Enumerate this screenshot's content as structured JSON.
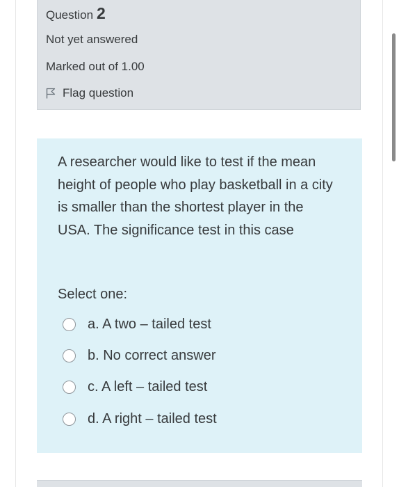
{
  "question_info": {
    "label": "Question",
    "number": "2",
    "state": "Not yet answered",
    "grade": "Marked out of 1.00",
    "flag_label": "Flag question"
  },
  "question": {
    "text": "A researcher would like to test if the mean height of people who play basketball in a city is smaller than the shortest player in the USA. The significance test in this case",
    "prompt": "Select one:",
    "options": [
      {
        "label": "a. A two – tailed test"
      },
      {
        "label": "b. No correct answer"
      },
      {
        "label": "c. A left – tailed test"
      },
      {
        "label": "d. A right – tailed test"
      }
    ]
  },
  "colors": {
    "info_background": "#dee2e6",
    "question_background": "#def2f8"
  }
}
